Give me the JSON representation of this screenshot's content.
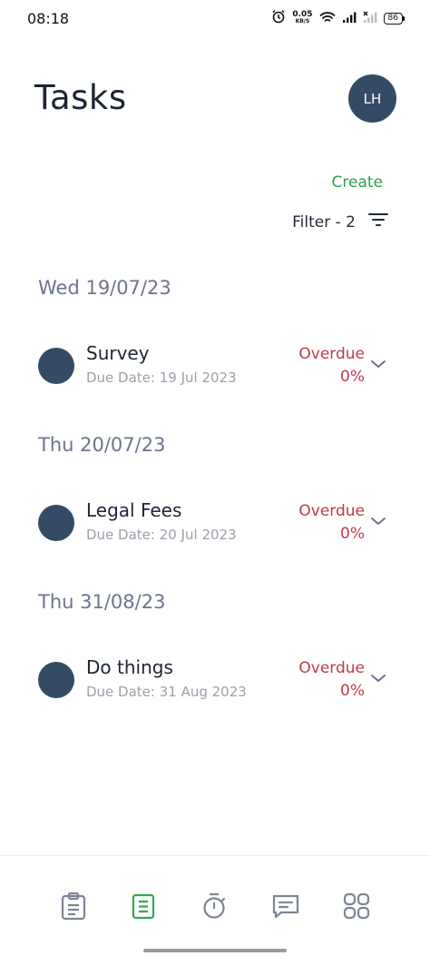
{
  "status_bar": {
    "time": "08:18",
    "net_speed_value": "0.05",
    "net_speed_unit": "KB/S",
    "battery": "86"
  },
  "header": {
    "title": "Tasks",
    "avatar_initials": "LH",
    "create_label": "Create",
    "filter_label": "Filter - 2"
  },
  "groups": [
    {
      "date": "Wed 19/07/23",
      "task": {
        "title": "Survey",
        "due": "Due Date: 19 Jul 2023",
        "status": "Overdue",
        "progress": "0%"
      }
    },
    {
      "date": "Thu 20/07/23",
      "task": {
        "title": "Legal Fees",
        "due": "Due Date: 20 Jul 2023",
        "status": "Overdue",
        "progress": "0%"
      }
    },
    {
      "date": "Thu 31/08/23",
      "task": {
        "title": "Do things",
        "due": "Due Date: 31 Aug 2023",
        "status": "Overdue",
        "progress": "0%"
      }
    }
  ],
  "bottom_nav": {
    "items": [
      "clipboard-icon",
      "tasks-list-icon",
      "timer-icon",
      "chat-icon",
      "apps-grid-icon"
    ],
    "active": "tasks-list-icon"
  },
  "colors": {
    "accent_green": "#2f9e4f",
    "overdue_red": "#c23a46",
    "dot_navy": "#344b65"
  }
}
